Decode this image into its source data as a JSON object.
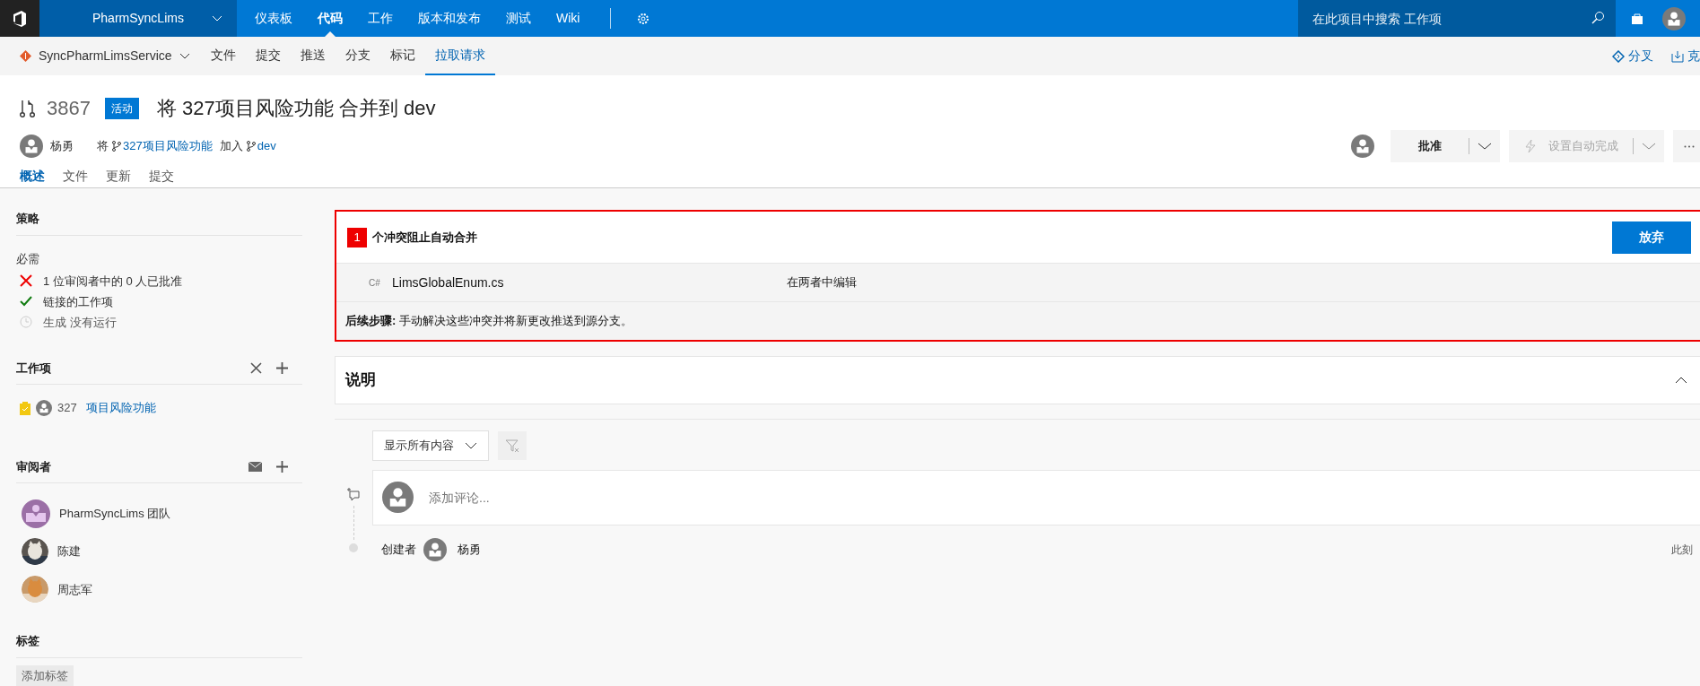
{
  "top_nav": {
    "project": "PharmSyncLims",
    "items": [
      {
        "label": "仪表板",
        "selected": false
      },
      {
        "label": "代码",
        "selected": true
      },
      {
        "label": "工作",
        "selected": false
      },
      {
        "label": "版本和发布",
        "selected": false
      },
      {
        "label": "测试",
        "selected": false
      },
      {
        "label": "Wiki",
        "selected": false
      }
    ],
    "search": {
      "placeholder": "在此项目中搜索 工作项"
    }
  },
  "repo_nav": {
    "repo": "SyncPharmLimsService",
    "items": [
      {
        "label": "文件",
        "selected": false
      },
      {
        "label": "提交",
        "selected": false
      },
      {
        "label": "推送",
        "selected": false
      },
      {
        "label": "分支",
        "selected": false
      },
      {
        "label": "标记",
        "selected": false
      },
      {
        "label": "拉取请求",
        "selected": true
      }
    ],
    "actions": [
      {
        "kind": "fork",
        "label": "分叉"
      },
      {
        "kind": "clone",
        "label": "克"
      }
    ]
  },
  "pull_request": {
    "id": "3867",
    "status": "活动",
    "title": "将 327项目风险功能 合并到 dev",
    "author": "杨勇",
    "merge_prefix": "将",
    "source_branch": "327项目风险功能",
    "merge_join": "加入",
    "target_branch": "dev",
    "tabs": [
      {
        "label": "概述",
        "selected": true
      },
      {
        "label": "文件",
        "selected": false
      },
      {
        "label": "更新",
        "selected": false
      },
      {
        "label": "提交",
        "selected": false
      }
    ],
    "approve": "批准",
    "auto_complete": {
      "label": "设置自动完成",
      "disabled": true
    }
  },
  "sidebar": {
    "policies": {
      "title": "策略",
      "required_label": "必需",
      "items": [
        {
          "kind": "failed",
          "text": "1 位审阅者中的 0 人已批准"
        },
        {
          "kind": "passed",
          "text": "链接的工作项"
        },
        {
          "kind": "pending",
          "text": "生成 没有运行"
        }
      ]
    },
    "work_items": {
      "title": "工作项",
      "items": [
        {
          "id": "327",
          "title": "项目风险功能"
        }
      ]
    },
    "reviewers": {
      "title": "审阅者",
      "items": [
        {
          "kind": "team",
          "name": "PharmSyncLims 团队"
        },
        {
          "kind": "picture",
          "name": "陈建"
        },
        {
          "kind": "picture",
          "name": "周志军"
        }
      ]
    },
    "tags": {
      "title": "标签",
      "add": "添加标签"
    }
  },
  "conflicts": {
    "count": "1",
    "message": "个冲突阻止自动合并",
    "abandon": "放弃",
    "files": [
      {
        "lang": "C#",
        "name": "LimsGlobalEnum.cs",
        "status": "在两者中编辑"
      }
    ],
    "next_steps": "**后续步骤:** 手动解决这些冲突并将新更改推送到源分支。"
  },
  "description": {
    "title": "说明",
    "expanded": true
  },
  "activity": {
    "filter": "显示所有内容",
    "comment_placeholder": "添加评论...",
    "created_label": "创建者",
    "created_by": "杨勇",
    "time": "此刻"
  }
}
